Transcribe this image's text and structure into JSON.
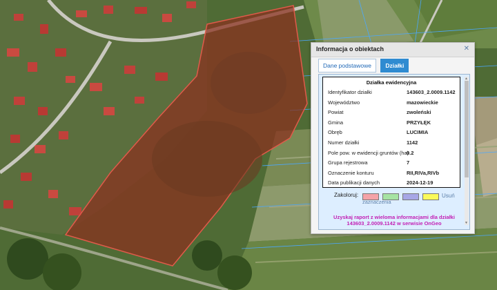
{
  "popup": {
    "title": "Informacja o obiektach",
    "close_icon": "close-icon",
    "tabs": [
      {
        "label": "Dane podstawowe",
        "active": true
      },
      {
        "label": "Działki",
        "active": false
      }
    ],
    "parcel_title": "Działka ewidencyjna",
    "rows": [
      {
        "label": "Identyfikator działki",
        "value": "143603_2.0009.1142"
      },
      {
        "label": "Województwo",
        "value": "mazowieckie"
      },
      {
        "label": "Powiat",
        "value": "zwoleński"
      },
      {
        "label": "Gmina",
        "value": "PRZYŁĘK"
      },
      {
        "label": "Obręb",
        "value": "LUCIMIA"
      },
      {
        "label": "Numer działki",
        "value": "1142"
      },
      {
        "label": "Pole pow. w ewidencji gruntów (ha)",
        "value": "0.2"
      },
      {
        "label": "Grupa rejestrowa",
        "value": "7"
      },
      {
        "label": "Oznaczenie konturu",
        "value": "RII,RIVa,RIVb"
      },
      {
        "label": "Data publikacji danych",
        "value": "2024-12-19"
      }
    ],
    "color_label": "Zakoloruj:",
    "colors": [
      "#f4a3a8",
      "#a6e3a3",
      "#a7a7e6",
      "#fafa5a"
    ],
    "highlight_label": "zaznaczenia",
    "remove_label": "Usuń",
    "report_line1": "Uzyskaj raport z wieloma informacjami dla działki",
    "report_line2": "143603_2.0009.1142 w serwisie OnGeo"
  },
  "map": {
    "parcel_fill": "#8a2f1f",
    "parcel_stroke": "#e05a4a",
    "boundary_color": "#4aa8ff"
  }
}
